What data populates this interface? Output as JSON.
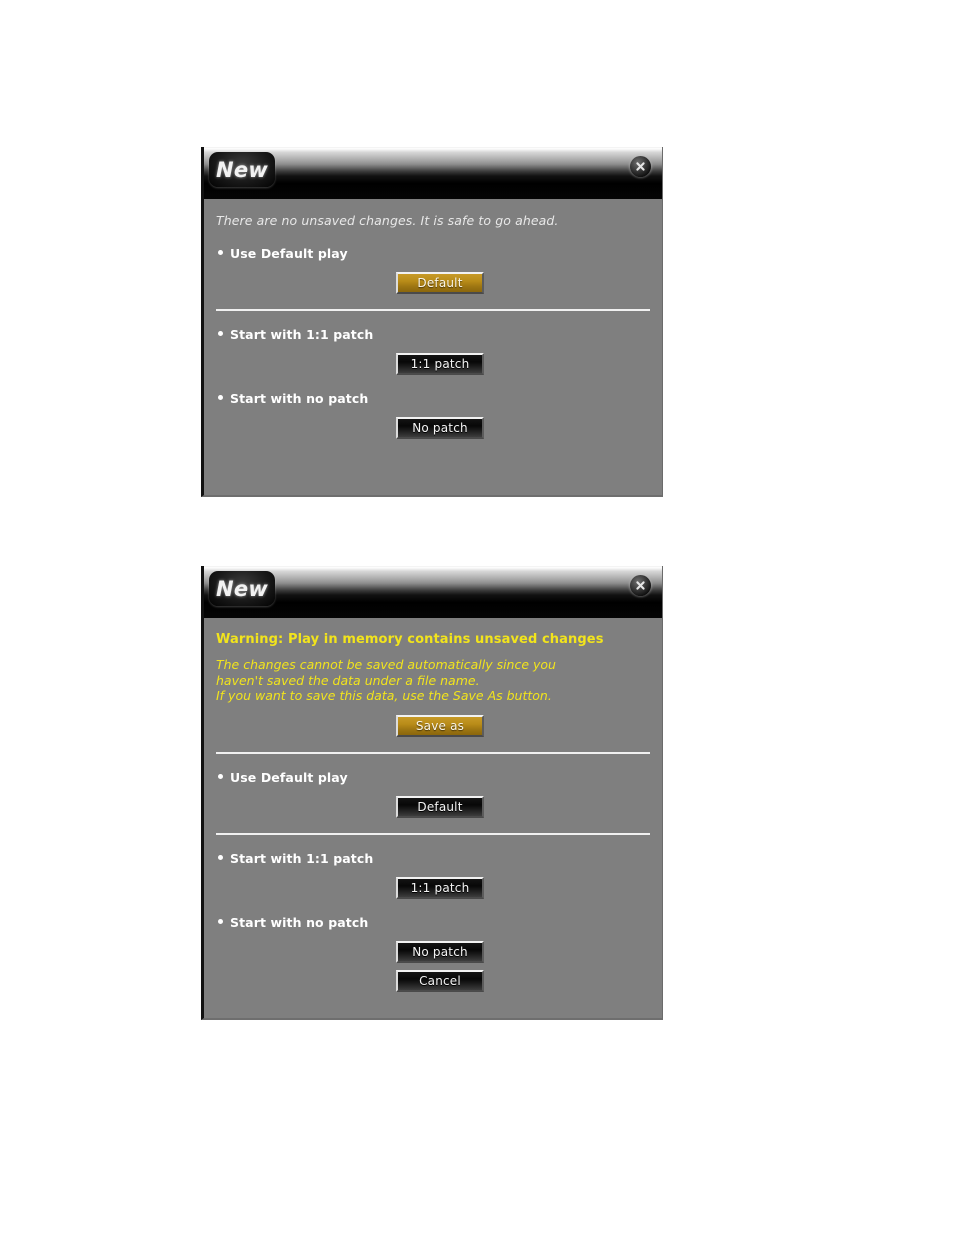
{
  "dialogs": [
    {
      "id": "no-unsaved-changes",
      "titlebar": {
        "tab_label": "New",
        "close_icon": "close-circle-icon"
      },
      "status_text": "There are no unsaved changes. It is safe to go ahead.",
      "options": [
        {
          "label": "Use Default play",
          "button": "Default",
          "style": "gold"
        },
        {
          "label": "Start with 1:1 patch",
          "button": "1:1 patch",
          "style": "dark"
        },
        {
          "label": "Start with no patch",
          "button": "No patch",
          "style": "dark"
        }
      ]
    },
    {
      "id": "unsaved-changes-warning",
      "titlebar": {
        "tab_label": "New",
        "close_icon": "close-circle-icon"
      },
      "warning_title": "Warning: Play in memory contains unsaved changes",
      "warning_lines": [
        "The changes cannot be saved automatically since you",
        "haven't saved the data under a file name.",
        "If you want to save this data, use the Save As button."
      ],
      "save_as_button": "Save as",
      "options": [
        {
          "label": "Use Default play",
          "button": "Default",
          "style": "dark"
        },
        {
          "label": "Start with 1:1 patch",
          "button": "1:1 patch",
          "style": "dark"
        },
        {
          "label": "Start with no patch",
          "button": "No patch",
          "style": "dark"
        }
      ],
      "cancel_button": "Cancel"
    }
  ],
  "colors": {
    "dialog_body": "#7f7f7f",
    "warning_text": "#f2e41c",
    "gold_button": "#b98c18",
    "label_text": "#ffffff",
    "status_text": "#e8e8e8"
  }
}
